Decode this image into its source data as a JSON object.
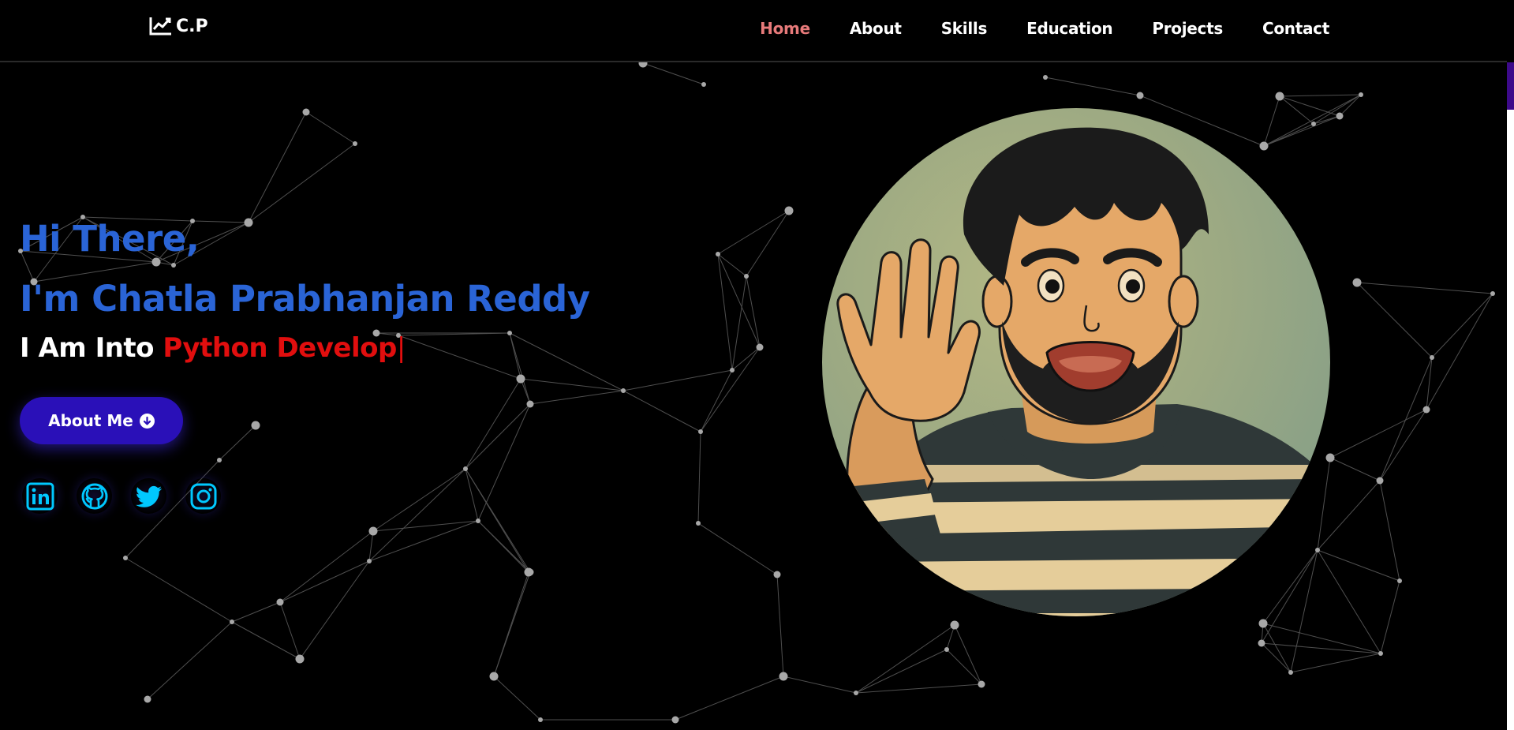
{
  "brand": {
    "name": "C.P",
    "icon": "chart-line-icon"
  },
  "nav": {
    "items": [
      {
        "label": "Home",
        "active": true
      },
      {
        "label": "About",
        "active": false
      },
      {
        "label": "Skills",
        "active": false
      },
      {
        "label": "Education",
        "active": false
      },
      {
        "label": "Projects",
        "active": false
      },
      {
        "label": "Contact",
        "active": false
      }
    ]
  },
  "hero": {
    "greeting_line1": "Hi There,",
    "greeting_line2": "I'm Chatla Prabhanjan Reddy",
    "into_prefix": "I Am Into ",
    "typed_text": "Python Develop",
    "cursor": "|",
    "about_button": "About Me"
  },
  "socials": [
    {
      "name": "linkedin",
      "icon": "linkedin-icon"
    },
    {
      "name": "github",
      "icon": "github-icon"
    },
    {
      "name": "twitter",
      "icon": "twitter-icon"
    },
    {
      "name": "instagram",
      "icon": "instagram-icon"
    }
  ],
  "colors": {
    "background": "#000000",
    "nav_active": "#e77a7a",
    "greeting": "#2a64d6",
    "typed": "#e10e0e",
    "button": "#2a10b8",
    "social_icon": "#00c8ff"
  }
}
